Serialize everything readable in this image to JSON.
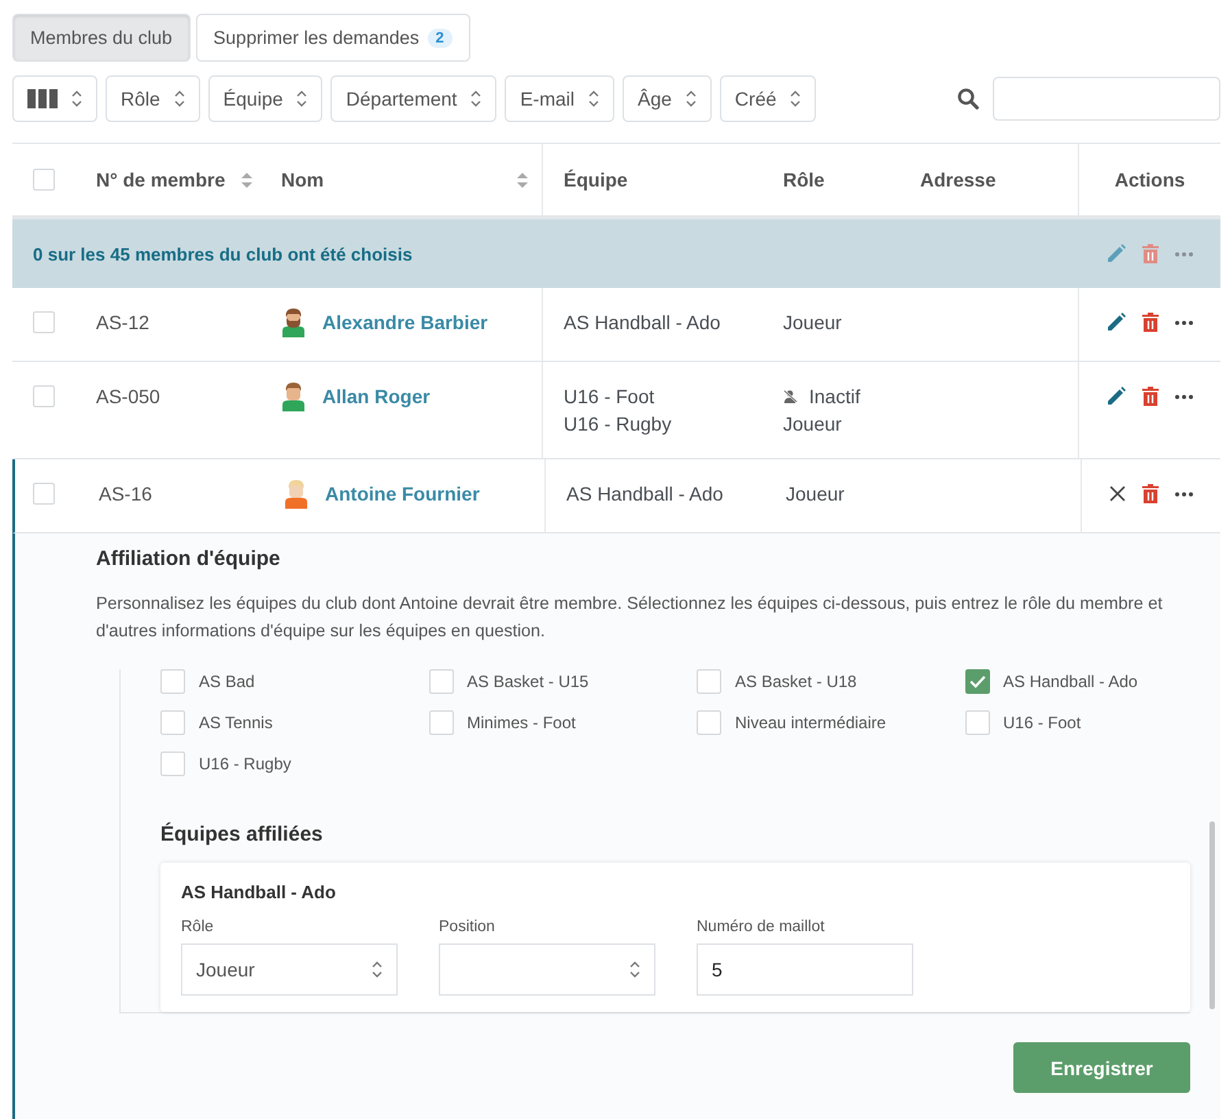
{
  "tabs": [
    {
      "label": "Membres du club",
      "selected": true
    },
    {
      "label": "Supprimer les demandes",
      "selected": false,
      "badge": "2"
    }
  ],
  "filters": [
    {
      "kind": "columns"
    },
    {
      "kind": "select",
      "label": "Rôle"
    },
    {
      "kind": "select",
      "label": "Équipe"
    },
    {
      "kind": "select",
      "label": "Département"
    },
    {
      "kind": "select",
      "label": "E-mail"
    },
    {
      "kind": "select",
      "label": "Âge"
    },
    {
      "kind": "select",
      "label": "Créé"
    }
  ],
  "table": {
    "all_checked": false,
    "columns": [
      {
        "label": "N° de membre",
        "sortable": true
      },
      {
        "label": "Nom",
        "sortable": true
      },
      {
        "label": "Équipe",
        "sortable": false
      },
      {
        "label": "Rôle",
        "sortable": false
      },
      {
        "label": "Adresse",
        "sortable": false
      },
      {
        "label": "Actions",
        "sortable": false
      }
    ],
    "selection_banner": "0 sur les 45 membres du club ont été choisis",
    "rows": [
      {
        "checked": false,
        "number": "AS-12",
        "name": "Alexandre Barbier",
        "avatar": {
          "kind": "bearded"
        },
        "teams": [
          "AS Handball - Ado"
        ],
        "roles": [
          {
            "label": "Joueur",
            "inactive": false
          }
        ],
        "expanded": false
      },
      {
        "checked": false,
        "number": "AS-050",
        "name": "Allan Roger",
        "avatar": {
          "kind": "brown"
        },
        "teams": [
          "U16 - Foot",
          "U16 - Rugby"
        ],
        "roles": [
          {
            "label": "Inactif",
            "inactive": true
          },
          {
            "label": "Joueur",
            "inactive": false
          }
        ],
        "expanded": false
      },
      {
        "checked": false,
        "number": "AS-16",
        "name": "Antoine Fournier",
        "avatar": {
          "kind": "blond"
        },
        "teams": [
          "AS Handball - Ado"
        ],
        "roles": [
          {
            "label": "Joueur",
            "inactive": false
          }
        ],
        "expanded": true
      }
    ]
  },
  "detail": {
    "title": "Affiliation d'équipe",
    "description": "Personnalisez les équipes du club dont Antoine devrait être membre. Sélectionnez les équipes ci-dessous, puis entrez le rôle du membre et d'autres informations d'équipe sur les équipes en question.",
    "teams": [
      {
        "label": "AS Bad",
        "checked": false
      },
      {
        "label": "AS Basket - U15",
        "checked": false
      },
      {
        "label": "AS Basket - U18",
        "checked": false
      },
      {
        "label": "AS Handball - Ado",
        "checked": true
      },
      {
        "label": "AS Tennis",
        "checked": false
      },
      {
        "label": "Minimes - Foot",
        "checked": false
      },
      {
        "label": "Niveau intermédiaire",
        "checked": false
      },
      {
        "label": "U16 - Foot",
        "checked": false
      },
      {
        "label": "U16 - Rugby",
        "checked": false
      }
    ],
    "affiliated_title": "Équipes affiliées",
    "cards": [
      {
        "title": "AS Handball - Ado",
        "fields": [
          {
            "kind": "select",
            "label": "Rôle",
            "value": "Joueur"
          },
          {
            "kind": "select",
            "label": "Position"
          },
          {
            "kind": "input",
            "label": "Numéro de maillot",
            "value": "5"
          }
        ]
      }
    ],
    "save": "Enregistrer"
  }
}
